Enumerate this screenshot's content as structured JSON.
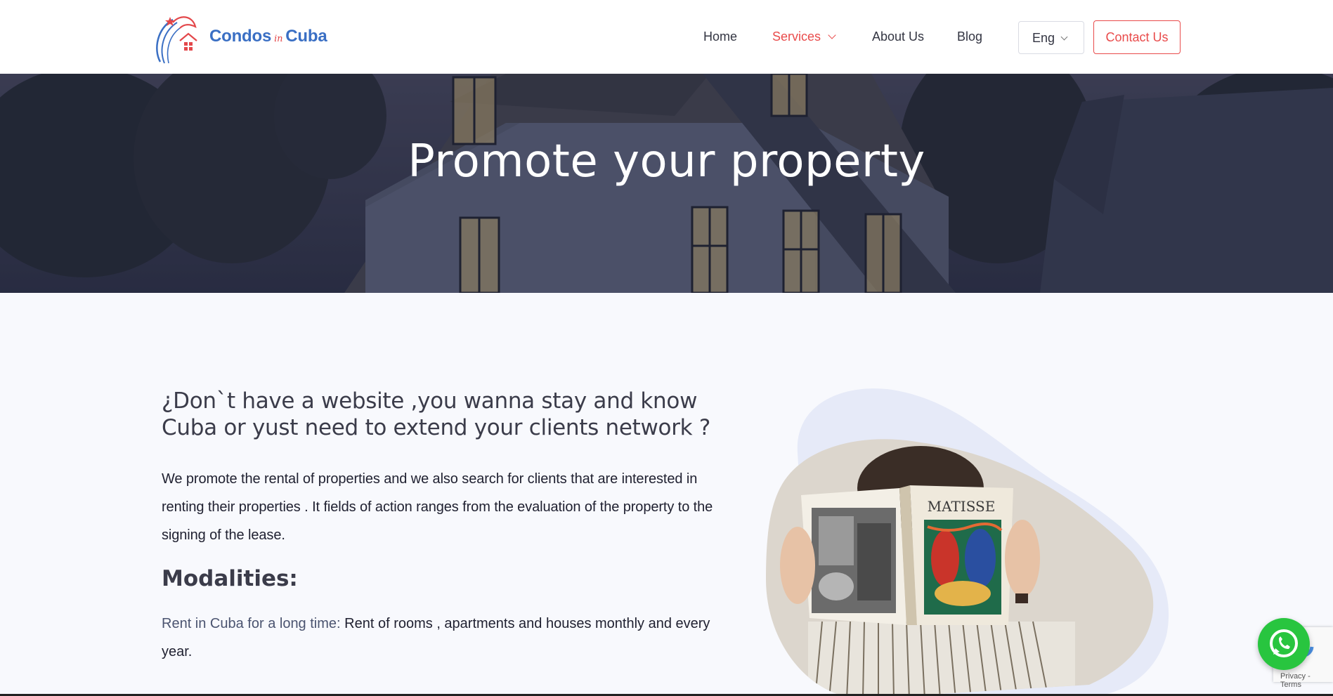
{
  "brand": {
    "name_left": "Condos",
    "name_mid": "in",
    "name_right": "Cuba"
  },
  "nav": {
    "home": "Home",
    "services": "Services",
    "about": "About Us",
    "blog": "Blog",
    "language": "Eng",
    "contact": "Contact Us"
  },
  "hero": {
    "title": "Promote your property"
  },
  "content": {
    "question": "¿Don`t have a website ,you wanna stay and know Cuba or yust need to extend your clients network ?",
    "intro": "We promote the rental of properties and we also search for clients that are interested in renting their  properties . It fields of action ranges from the evaluation of the property to the signing of the lease.",
    "modalities_heading": "Modalities:",
    "rent_label": "Rent in Cuba for a long time:",
    "rent_text": " Rent of rooms , apartments  and houses monthly and every year."
  },
  "book": {
    "title": "MATISSE"
  },
  "recaptcha": {
    "privacy": "Privacy",
    "terms": "Terms"
  },
  "colors": {
    "accent": "#e94b4b",
    "brand_blue": "#3a6fc4",
    "whatsapp": "#28c53f"
  }
}
